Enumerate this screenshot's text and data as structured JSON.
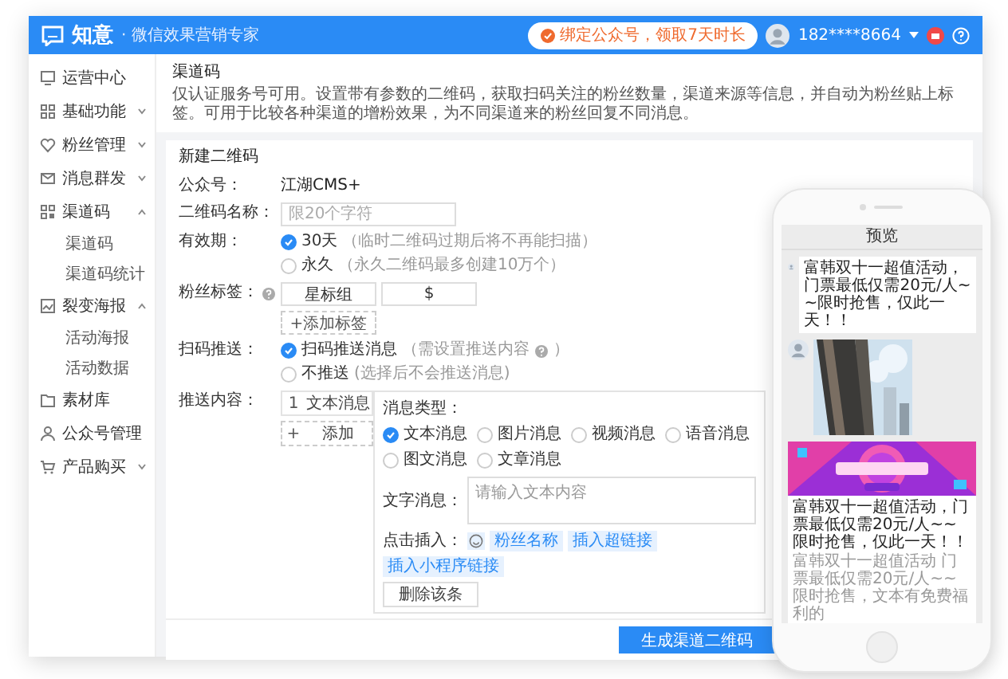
{
  "header": {
    "logo": "知意",
    "tagline": "· 微信效果营销专家",
    "promo": "绑定公众号，领取7天时长",
    "user": "182****8664"
  },
  "sidebar": {
    "items": [
      {
        "label": "运营中心"
      },
      {
        "label": "基础功能",
        "expanded": false
      },
      {
        "label": "粉丝管理",
        "expanded": false
      },
      {
        "label": "消息群发",
        "expanded": false
      },
      {
        "label": "渠道码",
        "expanded": true,
        "children": [
          {
            "label": "渠道码"
          },
          {
            "label": "渠道码统计"
          }
        ]
      },
      {
        "label": "裂变海报",
        "expanded": true,
        "children": [
          {
            "label": "活动海报"
          },
          {
            "label": "活动数据"
          }
        ]
      },
      {
        "label": "素材库"
      },
      {
        "label": "公众号管理"
      },
      {
        "label": "产品购买",
        "expanded": false
      }
    ]
  },
  "page": {
    "title": "渠道码",
    "description": "仅认证服务号可用。设置带有参数的二维码，获取扫码关注的粉丝数量，渠道来源等信息，并自动为粉丝贴上标签。可用于比较各种渠道的增粉效果，为不同渠道来的粉丝回复不同消息。"
  },
  "form": {
    "title": "新建二维码",
    "account": {
      "label": "公众号：",
      "value": "江湖CMS+"
    },
    "name": {
      "label": "二维码名称：",
      "placeholder": "限20个字符"
    },
    "validity": {
      "label": "有效期：",
      "options": [
        {
          "label": "30天",
          "note": "（临时二维码过期后将不再能扫描）",
          "selected": true
        },
        {
          "label": "永久",
          "note": "（永久二维码最多创建10万个）",
          "selected": false
        }
      ]
    },
    "tags": {
      "label": "粉丝标签：",
      "items": [
        "星标组",
        "$"
      ],
      "add": "+添加标签"
    },
    "push": {
      "label": "扫码推送：",
      "options": [
        {
          "label": "扫码推送消息",
          "note": "（需设置推送内容",
          "help": true,
          "note_end": "）",
          "selected": true
        },
        {
          "label": "不推送",
          "note": "(选择后不会推送消息)",
          "selected": false
        }
      ]
    },
    "content": {
      "label": "推送内容：",
      "messages": [
        {
          "index": "1",
          "label": "文本消息"
        }
      ],
      "add": {
        "index": "+",
        "label": "添加"
      },
      "panel": {
        "type_label": "消息类型：",
        "types": [
          {
            "label": "文本消息",
            "selected": true
          },
          {
            "label": "图片消息",
            "selected": false
          },
          {
            "label": "视频消息",
            "selected": false
          },
          {
            "label": "语音消息",
            "selected": false
          },
          {
            "label": "图文消息",
            "selected": false
          },
          {
            "label": "文章消息",
            "selected": false
          }
        ],
        "text_label": "文字消息：",
        "placeholder": "请输入文本内容",
        "insert_label": "点击插入：",
        "inserts": [
          "粉丝名称",
          "插入超链接",
          "插入小程序链接"
        ],
        "delete": "删除该条"
      }
    }
  },
  "footer": {
    "submit": "生成渠道二维码"
  },
  "phone": {
    "title": "预览",
    "messages": [
      {
        "kind": "text",
        "text": "富韩双十一超值活动，门票最低仅需20元/人~~限时抢售，仅此一天！！"
      },
      {
        "kind": "picture"
      },
      {
        "kind": "article",
        "title": "富韩双十一超值活动，门票最低仅需20元/人~~限时抢售，仅此一天！！",
        "description": "富韩双十一超值活动 门票最低仅需20元/人~~ 限时抢售，文本有免费福利的"
      }
    ]
  }
}
